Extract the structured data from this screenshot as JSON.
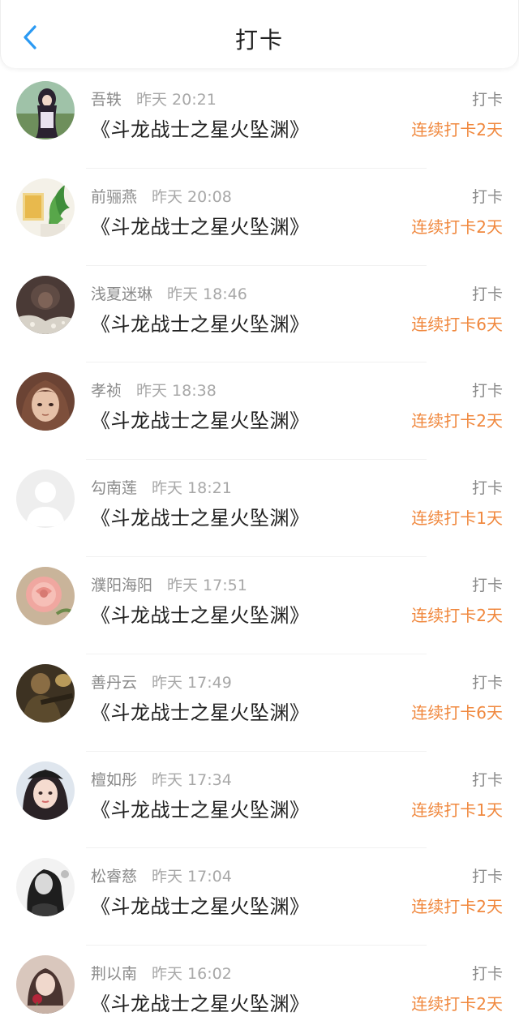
{
  "header": {
    "title": "打卡",
    "back_icon": "chevron-left-icon",
    "accent": "#2b9af3"
  },
  "colors": {
    "streak": "#f0883e",
    "muted": "#8a8a8a"
  },
  "entries": [
    {
      "name": "吾轶",
      "time": "昨天 20:21",
      "book": "《斗龙战士之星火坠渊》",
      "action": "打卡",
      "streak": "连续打卡2天",
      "avatar": "avatar-anime-girl"
    },
    {
      "name": "前骊燕",
      "time": "昨天 20:08",
      "book": "《斗龙战士之星火坠渊》",
      "action": "打卡",
      "streak": "连续打卡2天",
      "avatar": "avatar-plant"
    },
    {
      "name": "浅夏迷琳",
      "time": "昨天 18:46",
      "book": "《斗龙战士之星火坠渊》",
      "action": "打卡",
      "streak": "连续打卡6天",
      "avatar": "avatar-dark-photo"
    },
    {
      "name": "孝祯",
      "time": "昨天 18:38",
      "book": "《斗龙战士之星火坠渊》",
      "action": "打卡",
      "streak": "连续打卡2天",
      "avatar": "avatar-anime-face"
    },
    {
      "name": "勾南莲",
      "time": "昨天 18:21",
      "book": "《斗龙战士之星火坠渊》",
      "action": "打卡",
      "streak": "连续打卡1天",
      "avatar": "avatar-default"
    },
    {
      "name": "濮阳海阳",
      "time": "昨天 17:51",
      "book": "《斗龙战士之星火坠渊》",
      "action": "打卡",
      "streak": "连续打卡2天",
      "avatar": "avatar-rose"
    },
    {
      "name": "善丹云",
      "time": "昨天 17:49",
      "book": "《斗龙战士之星火坠渊》",
      "action": "打卡",
      "streak": "连续打卡6天",
      "avatar": "avatar-soldier"
    },
    {
      "name": "檀如彤",
      "time": "昨天 17:34",
      "book": "《斗龙战士之星火坠渊》",
      "action": "打卡",
      "streak": "连续打卡1天",
      "avatar": "avatar-girl-cap"
    },
    {
      "name": "松睿慈",
      "time": "昨天 17:04",
      "book": "《斗龙战士之星火坠渊》",
      "action": "打卡",
      "streak": "连续打卡2天",
      "avatar": "avatar-bw-photo"
    },
    {
      "name": "荆以南",
      "time": "昨天 16:02",
      "book": "《斗龙战士之星火坠渊》",
      "action": "打卡",
      "streak": "连续打卡2天",
      "avatar": "avatar-girl-flower"
    }
  ]
}
